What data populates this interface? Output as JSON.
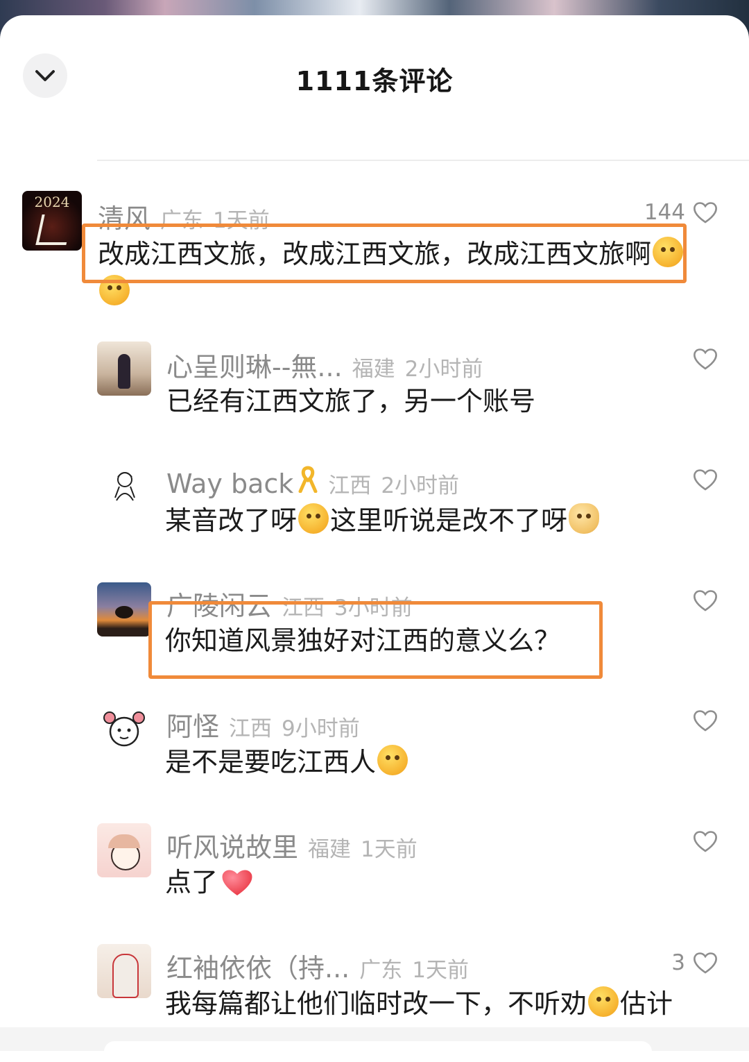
{
  "header": {
    "title": "1111条评论",
    "collapse_icon": "chevron-down-icon"
  },
  "comments": [
    {
      "name": "清风",
      "region": "广东",
      "time": "1天前",
      "likes": "144",
      "text1": "改成江西文旅，改成江西文旅，改成江西文旅啊",
      "avatar_text": "2024"
    },
    {
      "name": "心呈则琳--無...",
      "region": "福建",
      "time": "2小时前",
      "likes": "",
      "text1": "已经有江西文旅了，另一个账号"
    },
    {
      "name": "Way back",
      "region": "江西",
      "time": "2小时前",
      "likes": "",
      "text_a": "某音改了呀",
      "text_b": "这里听说是改不了呀"
    },
    {
      "name": "广陵闲云",
      "region": "江西",
      "time": "3小时前",
      "likes": "",
      "text1": "你知道风景独好对江西的意义么？"
    },
    {
      "name": "阿怪",
      "region": "江西",
      "time": "9小时前",
      "likes": "",
      "text1": "是不是要吃江西人"
    },
    {
      "name": "听风说故里",
      "region": "福建",
      "time": "1天前",
      "likes": "",
      "text1": "点了"
    },
    {
      "name": "红袖依依（持...",
      "region": "广东",
      "time": "1天前",
      "likes": "3",
      "text_a": "我每篇都让他们临时改一下，不听劝",
      "text_b": "估计"
    }
  ],
  "colors": {
    "highlight": "#f08a3a",
    "meta": "#b4b4b4",
    "name": "#8a8a8a"
  }
}
